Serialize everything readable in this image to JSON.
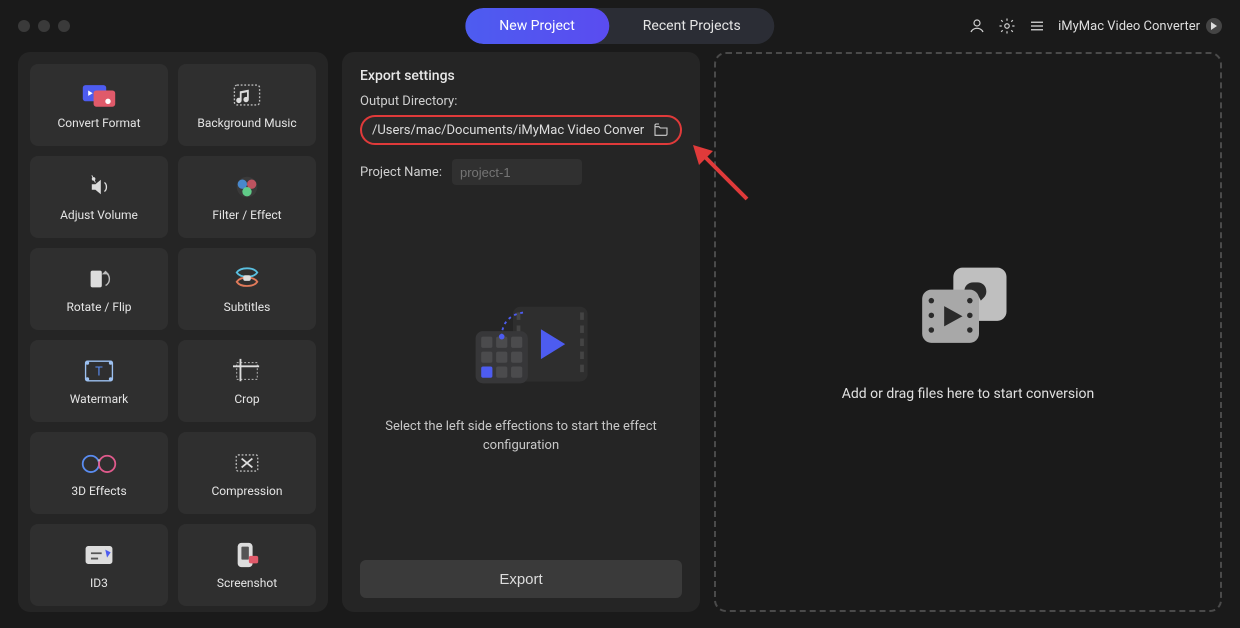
{
  "titlebar": {
    "tabs": {
      "new_project": "New Project",
      "recent_projects": "Recent Projects"
    },
    "app_name": "iMyMac Video Converter"
  },
  "sidebar": {
    "tools": [
      {
        "id": "convert-format",
        "label": "Convert Format",
        "icon": "convert"
      },
      {
        "id": "background-music",
        "label": "Background Music",
        "icon": "music"
      },
      {
        "id": "adjust-volume",
        "label": "Adjust Volume",
        "icon": "volume"
      },
      {
        "id": "filter-effect",
        "label": "Filter / Effect",
        "icon": "fx"
      },
      {
        "id": "rotate-flip",
        "label": "Rotate / Flip",
        "icon": "rotate"
      },
      {
        "id": "subtitles",
        "label": "Subtitles",
        "icon": "subs"
      },
      {
        "id": "watermark",
        "label": "Watermark",
        "icon": "watermark"
      },
      {
        "id": "crop",
        "label": "Crop",
        "icon": "crop"
      },
      {
        "id": "3d-effects",
        "label": "3D Effects",
        "icon": "3d"
      },
      {
        "id": "compression",
        "label": "Compression",
        "icon": "compress"
      },
      {
        "id": "id3",
        "label": "ID3",
        "icon": "id3"
      },
      {
        "id": "screenshot",
        "label": "Screenshot",
        "icon": "snap"
      }
    ]
  },
  "export": {
    "title": "Export settings",
    "output_dir_label": "Output Directory:",
    "output_dir": "/Users/mac/Documents/iMyMac Video Converte",
    "project_name_label": "Project Name:",
    "project_name_placeholder": "project-1",
    "instructions": "Select the left side effections to start the effect configuration",
    "export_button": "Export"
  },
  "dropzone": {
    "text": "Add or drag files here to start conversion"
  }
}
